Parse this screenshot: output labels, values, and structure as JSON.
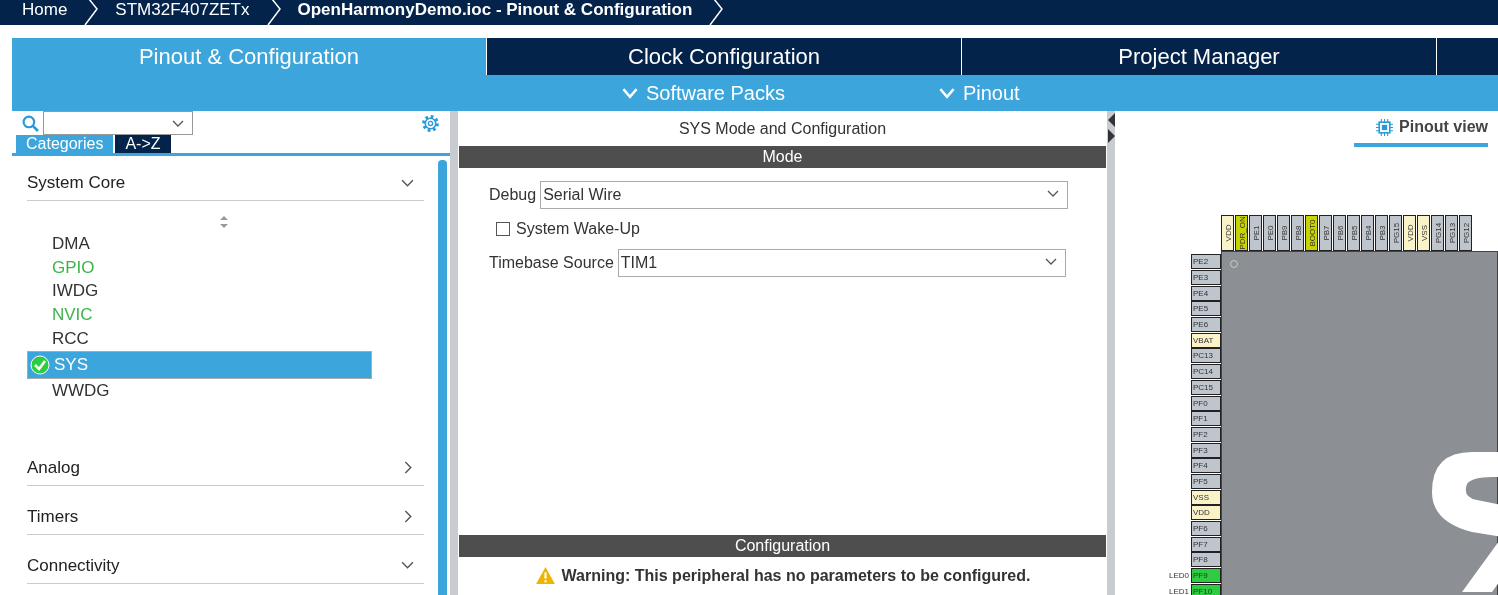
{
  "breadcrumb": [
    "Home",
    "STM32F407ZETx",
    "OpenHarmonyDemo.ioc - Pinout & Configuration"
  ],
  "tabs": [
    {
      "label": "Pinout & Configuration",
      "selected": true
    },
    {
      "label": "Clock Configuration",
      "selected": false
    },
    {
      "label": "Project Manager",
      "selected": false
    }
  ],
  "subtabs": [
    "Software Packs",
    "Pinout"
  ],
  "sidebar": {
    "view_tabs": [
      {
        "label": "Categories",
        "selected": true
      },
      {
        "label": "A->Z",
        "selected": false
      }
    ],
    "categories": [
      {
        "label": "System Core",
        "expanded": true,
        "children": [
          {
            "label": "DMA",
            "configured": false,
            "selected": false,
            "checked": false
          },
          {
            "label": "GPIO",
            "configured": true,
            "selected": false,
            "checked": false
          },
          {
            "label": "IWDG",
            "configured": false,
            "selected": false,
            "checked": false
          },
          {
            "label": "NVIC",
            "configured": true,
            "selected": false,
            "checked": false
          },
          {
            "label": "RCC",
            "configured": false,
            "selected": false,
            "checked": false
          },
          {
            "label": "SYS",
            "configured": false,
            "selected": true,
            "checked": true
          },
          {
            "label": "WWDG",
            "configured": false,
            "selected": false,
            "checked": false
          }
        ]
      },
      {
        "label": "Analog",
        "expanded": false
      },
      {
        "label": "Timers",
        "expanded": false
      },
      {
        "label": "Connectivity",
        "expanded": true
      }
    ]
  },
  "panel": {
    "title": "SYS Mode and Configuration",
    "mode_header": "Mode",
    "debug": {
      "label": "Debug",
      "value": "Serial Wire"
    },
    "wakeup": {
      "label": "System Wake-Up",
      "checked": false
    },
    "timebase": {
      "label": "Timebase Source",
      "value": "TIM1"
    },
    "config_header": "Configuration",
    "warning": "Warning: This peripheral has no parameters to be configured."
  },
  "pinout": {
    "view_tab": "Pinout view",
    "top_pins": [
      {
        "label": "VDD",
        "kind": "power"
      },
      {
        "label": "PDR_ON",
        "kind": "fixed"
      },
      {
        "label": "PE1",
        "kind": "io"
      },
      {
        "label": "PE0",
        "kind": "io"
      },
      {
        "label": "PB9",
        "kind": "io"
      },
      {
        "label": "PB8",
        "kind": "io"
      },
      {
        "label": "BOOT0",
        "kind": "fixed"
      },
      {
        "label": "PB7",
        "kind": "io"
      },
      {
        "label": "PB6",
        "kind": "io"
      },
      {
        "label": "PB5",
        "kind": "io"
      },
      {
        "label": "PB4",
        "kind": "io"
      },
      {
        "label": "PB3",
        "kind": "io"
      },
      {
        "label": "PG15",
        "kind": "io"
      },
      {
        "label": "VDD",
        "kind": "power"
      },
      {
        "label": "VSS",
        "kind": "power"
      },
      {
        "label": "PG14",
        "kind": "io"
      },
      {
        "label": "PG13",
        "kind": "io"
      },
      {
        "label": "PG12",
        "kind": "io"
      }
    ],
    "left_pins": [
      {
        "label": "PE2",
        "kind": "io"
      },
      {
        "label": "PE3",
        "kind": "io"
      },
      {
        "label": "PE4",
        "kind": "io"
      },
      {
        "label": "PE5",
        "kind": "io"
      },
      {
        "label": "PE6",
        "kind": "io"
      },
      {
        "label": "VBAT",
        "kind": "power"
      },
      {
        "label": "PC13",
        "kind": "io"
      },
      {
        "label": "PC14",
        "kind": "io"
      },
      {
        "label": "PC15",
        "kind": "io"
      },
      {
        "label": "PF0",
        "kind": "io"
      },
      {
        "label": "PF1",
        "kind": "io"
      },
      {
        "label": "PF2",
        "kind": "io"
      },
      {
        "label": "PF3",
        "kind": "io"
      },
      {
        "label": "PF4",
        "kind": "io"
      },
      {
        "label": "PF5",
        "kind": "io"
      },
      {
        "label": "VSS",
        "kind": "power"
      },
      {
        "label": "VDD",
        "kind": "power"
      },
      {
        "label": "PF6",
        "kind": "io"
      },
      {
        "label": "PF7",
        "kind": "io"
      },
      {
        "label": "PF8",
        "kind": "io"
      },
      {
        "label": "PF9",
        "kind": "assigned",
        "signal": "LED0"
      },
      {
        "label": "PF10",
        "kind": "assigned",
        "signal": "LED1"
      }
    ]
  }
}
